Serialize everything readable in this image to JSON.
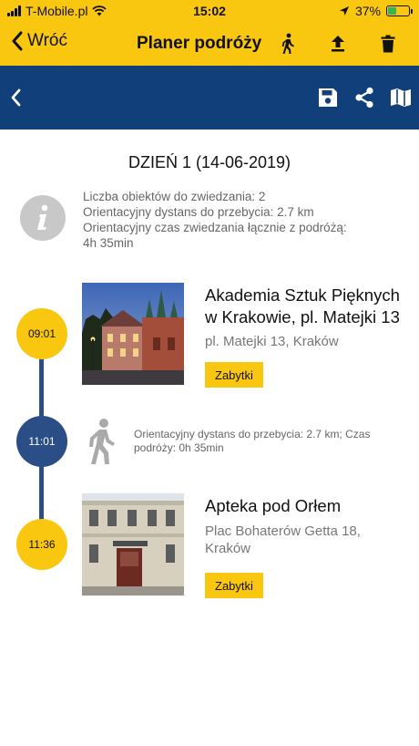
{
  "status_bar": {
    "carrier": "T-Mobile.pl",
    "time": "15:02",
    "battery": "37%",
    "battery_level": 0.37,
    "icons": [
      "signal-icon",
      "wifi-icon",
      "location-arrow-icon",
      "battery-icon"
    ]
  },
  "nav": {
    "back_label": "Wróć",
    "title": "Planer podróży",
    "icons": [
      "walking-person-icon",
      "upload-icon",
      "trash-icon"
    ]
  },
  "toolbar": {
    "icons": [
      "chevron-left-icon",
      "save-icon",
      "share-icon",
      "map-icon"
    ]
  },
  "day": {
    "heading": "DZIEŃ 1 (14-06-2019)",
    "info_lines": [
      "Liczba obiektów do zwiedzania: 2",
      "Orientacyjny dystans do przebycia: 2.7 km",
      "Orientacyjny czas zwiedzania łącznie z podróżą:",
      "4h 35min"
    ]
  },
  "stops": [
    {
      "time": "09:01",
      "title": "Akademia Sztuk Pięknych w Krakowie, pl. Matejki 13",
      "address": "pl. Matejki 13, Kraków",
      "tag": "Zabytki"
    },
    {
      "time": "11:36",
      "title": "Apteka pod Orłem",
      "address": "Plac Bohaterów Getta 18, Kraków",
      "tag": "Zabytki"
    }
  ],
  "travel": {
    "time": "11:01",
    "text": "Orientacyjny dystans do przebycia: 2.7 km; Czas podróży: 0h 35min"
  },
  "colors": {
    "accent_yellow": "#F9C610",
    "toolbar_blue": "#113F7A",
    "timeline_blue": "#2B4E86"
  }
}
